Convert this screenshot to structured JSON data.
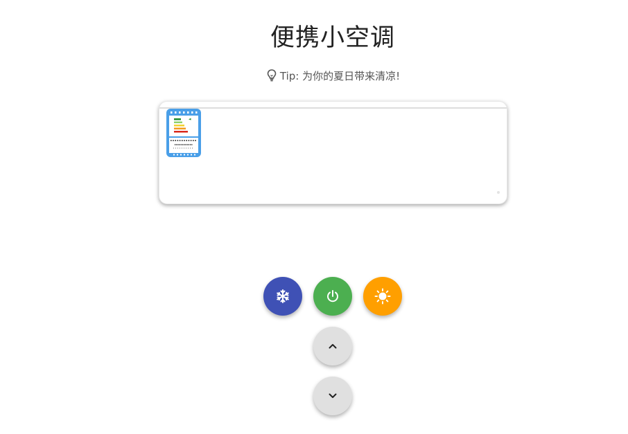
{
  "title": "便携小空调",
  "tip": {
    "icon": "lightbulb-icon",
    "text": "Tip: 为你的夏日带来清凉!"
  },
  "ac_unit": {
    "label_icon": "energy-label-icon",
    "colors": {
      "body": "#ffffff",
      "label_frame": "#4a9fe8"
    }
  },
  "controls": {
    "cool": {
      "icon": "snowflake-icon",
      "color": "#3f51b5"
    },
    "power": {
      "icon": "power-icon",
      "color": "#4caf50"
    },
    "heat": {
      "icon": "sun-icon",
      "color": "#ff9f00"
    },
    "temp_up": {
      "icon": "chevron-up-icon",
      "color": "#e0e0e0"
    },
    "temp_down": {
      "icon": "chevron-down-icon",
      "color": "#e0e0e0"
    }
  }
}
